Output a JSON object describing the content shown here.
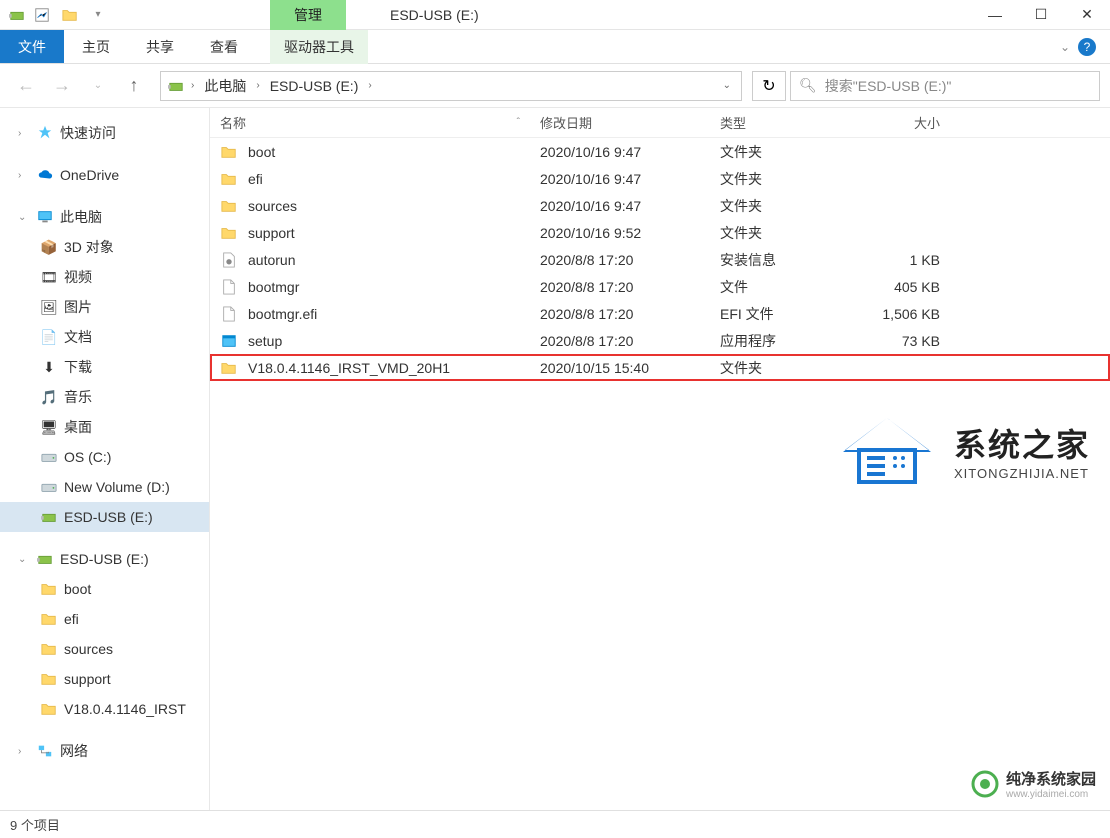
{
  "window": {
    "title": "ESD-USB (E:)",
    "manage_tab": "管理",
    "drive_tools": "驱动器工具"
  },
  "ribbon": {
    "file": "文件",
    "home": "主页",
    "share": "共享",
    "view": "查看"
  },
  "breadcrumb": {
    "seg1": "此电脑",
    "seg2": "ESD-USB (E:)"
  },
  "search": {
    "placeholder": "搜索\"ESD-USB (E:)\""
  },
  "columns": {
    "name": "名称",
    "date": "修改日期",
    "type": "类型",
    "size": "大小"
  },
  "sidebar": {
    "quick_access": "快速访问",
    "onedrive": "OneDrive",
    "this_pc": "此电脑",
    "objects_3d": "3D 对象",
    "videos": "视频",
    "pictures": "图片",
    "documents": "文档",
    "downloads": "下载",
    "music": "音乐",
    "desktop": "桌面",
    "os_c": "OS (C:)",
    "new_volume_d": "New Volume (D:)",
    "esd_usb_e": "ESD-USB (E:)",
    "esd_usb_e2": "ESD-USB (E:)",
    "boot": "boot",
    "efi": "efi",
    "sources": "sources",
    "support": "support",
    "irst": "V18.0.4.1146_IRST",
    "network": "网络"
  },
  "files": [
    {
      "icon": "folder",
      "name": "boot",
      "date": "2020/10/16 9:47",
      "type": "文件夹",
      "size": ""
    },
    {
      "icon": "folder",
      "name": "efi",
      "date": "2020/10/16 9:47",
      "type": "文件夹",
      "size": ""
    },
    {
      "icon": "folder",
      "name": "sources",
      "date": "2020/10/16 9:47",
      "type": "文件夹",
      "size": ""
    },
    {
      "icon": "folder",
      "name": "support",
      "date": "2020/10/16 9:52",
      "type": "文件夹",
      "size": ""
    },
    {
      "icon": "inf",
      "name": "autorun",
      "date": "2020/8/8 17:20",
      "type": "安装信息",
      "size": "1 KB"
    },
    {
      "icon": "file",
      "name": "bootmgr",
      "date": "2020/8/8 17:20",
      "type": "文件",
      "size": "405 KB"
    },
    {
      "icon": "file",
      "name": "bootmgr.efi",
      "date": "2020/8/8 17:20",
      "type": "EFI 文件",
      "size": "1,506 KB"
    },
    {
      "icon": "exe",
      "name": "setup",
      "date": "2020/8/8 17:20",
      "type": "应用程序",
      "size": "73 KB"
    },
    {
      "icon": "folder",
      "name": "V18.0.4.1146_IRST_VMD_20H1",
      "date": "2020/10/15 15:40",
      "type": "文件夹",
      "size": "",
      "highlighted": true
    }
  ],
  "status": {
    "item_count": "9 个项目"
  },
  "watermark1": {
    "title": "系统之家",
    "sub": "XITONGZHIJIA.NET"
  },
  "watermark2": {
    "title": "纯净系统家园",
    "sub": "www.yidaimei.com"
  }
}
